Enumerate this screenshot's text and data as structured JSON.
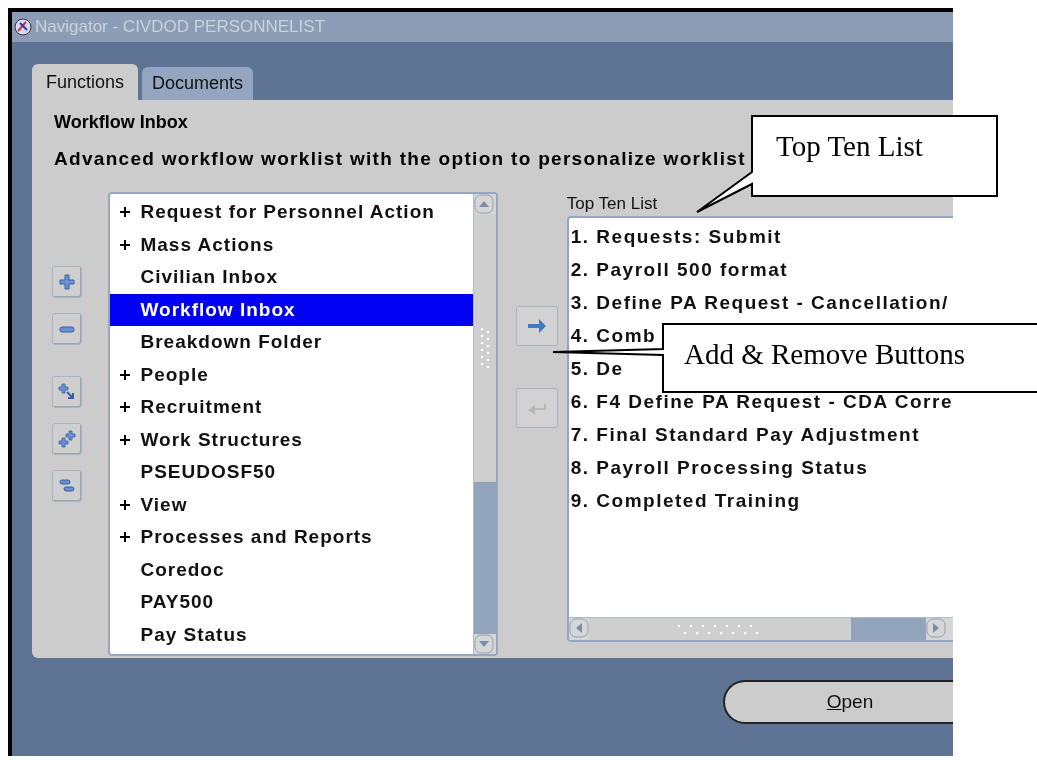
{
  "window": {
    "title": "Navigator - CIVDOD PERSONNELIST"
  },
  "tabs": [
    {
      "label": "Functions",
      "selected": true
    },
    {
      "label": "Documents",
      "selected": false
    }
  ],
  "heading": "Workflow Inbox",
  "description": "Advanced workflow worklist with the option to personalize worklist",
  "tree_buttons": [
    {
      "kind": "expand",
      "disabled": false
    },
    {
      "kind": "collapse",
      "disabled": false
    },
    {
      "kind": "expand-branch",
      "disabled": false
    },
    {
      "kind": "expand-all",
      "disabled": false
    },
    {
      "kind": "collapse-all",
      "disabled": false
    }
  ],
  "function_list": {
    "items": [
      {
        "label": "Request for Personnel Action",
        "kind": "folder",
        "selected": false
      },
      {
        "label": "Mass Actions",
        "kind": "folder",
        "selected": false
      },
      {
        "label": "Civilian Inbox",
        "kind": "function",
        "selected": false
      },
      {
        "label": "Workflow Inbox",
        "kind": "function",
        "selected": true
      },
      {
        "label": "Breakdown Folder",
        "kind": "function",
        "selected": false
      },
      {
        "label": "People",
        "kind": "folder",
        "selected": false
      },
      {
        "label": "Recruitment",
        "kind": "folder",
        "selected": false
      },
      {
        "label": "Work Structures",
        "kind": "folder",
        "selected": false
      },
      {
        "label": "PSEUDOSF50",
        "kind": "function",
        "selected": false
      },
      {
        "label": "View",
        "kind": "folder",
        "selected": false
      },
      {
        "label": "Processes and Reports",
        "kind": "folder",
        "selected": false
      },
      {
        "label": "Coredoc",
        "kind": "function",
        "selected": false
      },
      {
        "label": "PAY500",
        "kind": "function",
        "selected": false
      },
      {
        "label": "Pay Status",
        "kind": "function",
        "selected": false
      }
    ]
  },
  "move_buttons": [
    {
      "kind": "add",
      "disabled": false
    },
    {
      "kind": "remove",
      "disabled": true
    }
  ],
  "top_ten": {
    "label": "Top Ten List",
    "items": [
      "1. Requests: Submit",
      "2. Payroll 500 format",
      "3. Define PA Request - Cancellation/",
      "4. Comb",
      "5. De",
      "6. F4 Define PA Request - CDA Corre",
      "7. Final Standard Pay Adjustment",
      "8. Payroll Processing Status",
      "9. Completed Training"
    ]
  },
  "open_button": {
    "label": "Open"
  },
  "callouts": [
    {
      "kind": "top-ten",
      "text": "Top Ten List"
    },
    {
      "kind": "add-remove",
      "text": "Add & Remove Buttons"
    }
  ]
}
